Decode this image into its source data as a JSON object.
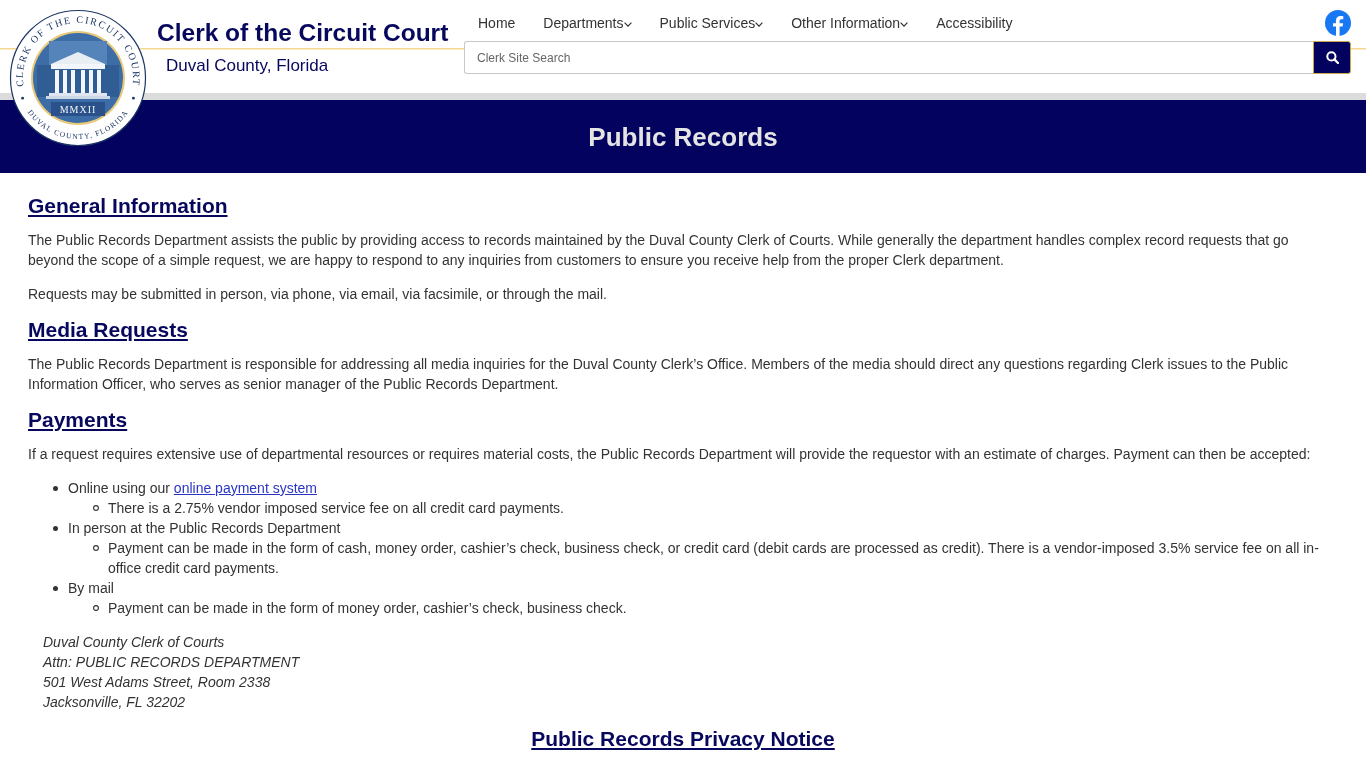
{
  "header": {
    "seal": {
      "top_text": "CLERK OF THE CIRCUIT COURT",
      "bottom_text": "DUVAL COUNTY, FLORIDA",
      "year": "MMXII"
    },
    "title": "Clerk of the Circuit Court",
    "subtitle": "Duval County, Florida"
  },
  "nav": {
    "items": [
      {
        "label": "Home",
        "has_menu": false
      },
      {
        "label": "Departments",
        "has_menu": true
      },
      {
        "label": "Public Services",
        "has_menu": true
      },
      {
        "label": "Other Information",
        "has_menu": true
      },
      {
        "label": "Accessibility",
        "has_menu": false
      }
    ]
  },
  "search": {
    "placeholder": "Clerk Site Search"
  },
  "banner": {
    "title": "Public Records"
  },
  "sections": [
    {
      "heading": "General Information",
      "paragraphs": [
        "The Public Records Department assists the public by providing access to records maintained by the Duval County Clerk of Courts. While generally the department handles complex record requests that go beyond the scope of a simple request, we are happy to respond to any inquiries from customers to ensure you receive help from the proper Clerk department.",
        "Requests may be submitted in person, via phone, via email, via facsimile, or through the mail."
      ]
    },
    {
      "heading": "Media Requests",
      "paragraphs": [
        "The Public Records Department is responsible for addressing all media inquiries for the Duval County Clerk’s Office. Members of the media should direct any questions regarding Clerk issues to the Public Information Officer, who serves as senior manager of the Public Records Department."
      ]
    },
    {
      "heading": "Payments",
      "paragraphs": [
        "If a request requires extensive use of departmental resources or requires material costs, the Public Records Department will provide the requestor with an estimate of charges. Payment can then be accepted:"
      ],
      "list": [
        {
          "text": "Online using our",
          "link": "online payment system",
          "children": [
            {
              "text": "There is a 2.75% vendor imposed service fee on all credit card payments."
            }
          ]
        },
        {
          "text": "In person at the Public Records Department",
          "children": [
            {
              "text": "Payment can be made in the form of cash, money order, cashier’s check, business check, or credit card (debit cards are processed as credit). There is a vendor-imposed 3.5% service fee on all in-office credit card payments."
            }
          ]
        },
        {
          "text": "By mail",
          "children": [
            {
              "text": "Payment can be made in the form of money order, cashier’s check, business check."
            }
          ]
        }
      ],
      "address": [
        "Duval County Clerk of Courts",
        "Attn: PUBLIC RECORDS DEPARTMENT",
        "501 West Adams Street, Room 2338",
        "Jacksonville, FL 32202"
      ]
    }
  ],
  "footer_link": "Public Records Privacy Notice"
}
